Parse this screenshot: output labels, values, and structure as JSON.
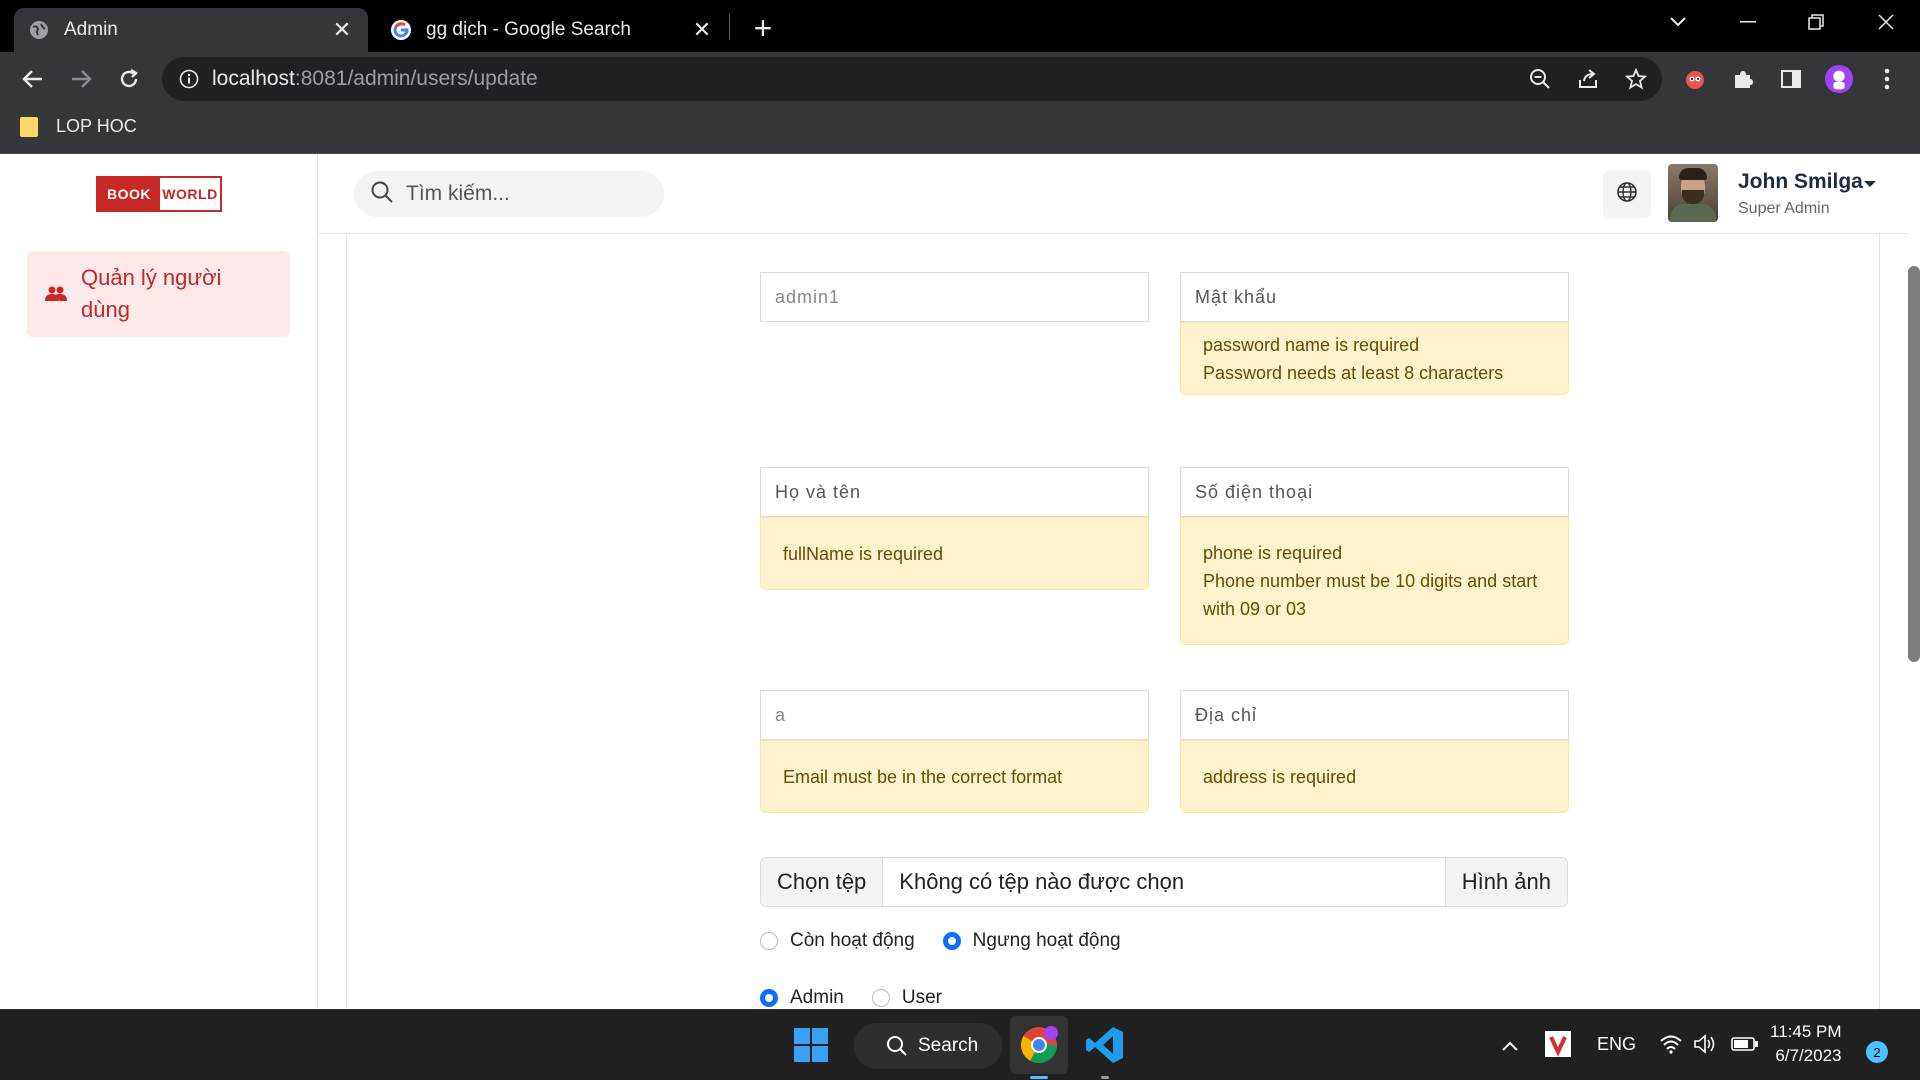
{
  "browser": {
    "tabs": [
      {
        "title": "Admin",
        "icon": "globe-icon"
      },
      {
        "title": "gg dịch - Google Search",
        "icon": "google-icon"
      }
    ],
    "url_host": "localhost",
    "url_path": ":8081/admin/users/update",
    "bookmark": "LOP HOC"
  },
  "app": {
    "logo_left": "BOOK",
    "logo_right": "WORLD",
    "sidebar_item": "Quản lý người dùng",
    "search_placeholder": "Tìm kiếm...",
    "user_name": "John Smilga",
    "user_role": "Super Admin"
  },
  "form": {
    "username_value": "admin1",
    "password_placeholder": "Mật khẩu",
    "password_errors": [
      "password name is required",
      "Password needs at least 8 characters"
    ],
    "fullname_placeholder": "Họ và tên",
    "fullname_error": "fullName is required",
    "phone_placeholder": "Số điện thoại",
    "phone_errors": [
      "phone is required",
      "Phone number must be 10 digits and start with 09 or 03"
    ],
    "email_value": "a",
    "email_error": "Email must be in the correct format",
    "address_placeholder": "Địa chỉ",
    "address_error": "address is required",
    "file_button": "Chọn tệp",
    "file_name": "Không có tệp nào được chọn",
    "file_label": "Hình ảnh",
    "status_options": [
      "Còn hoạt động",
      "Ngưng hoạt động"
    ],
    "status_selected": "Ngưng hoạt động",
    "role_options": [
      "Admin",
      "User"
    ],
    "role_selected": "Admin"
  },
  "taskbar": {
    "search_label": "Search",
    "language": "ENG",
    "time": "11:45 PM",
    "date": "6/7/2023",
    "notification_count": "2"
  },
  "colors": {
    "accent_red": "#c62828",
    "alert_bg": "#fff3cd",
    "alert_text": "#664d03",
    "radio_blue": "#0d6efd"
  }
}
